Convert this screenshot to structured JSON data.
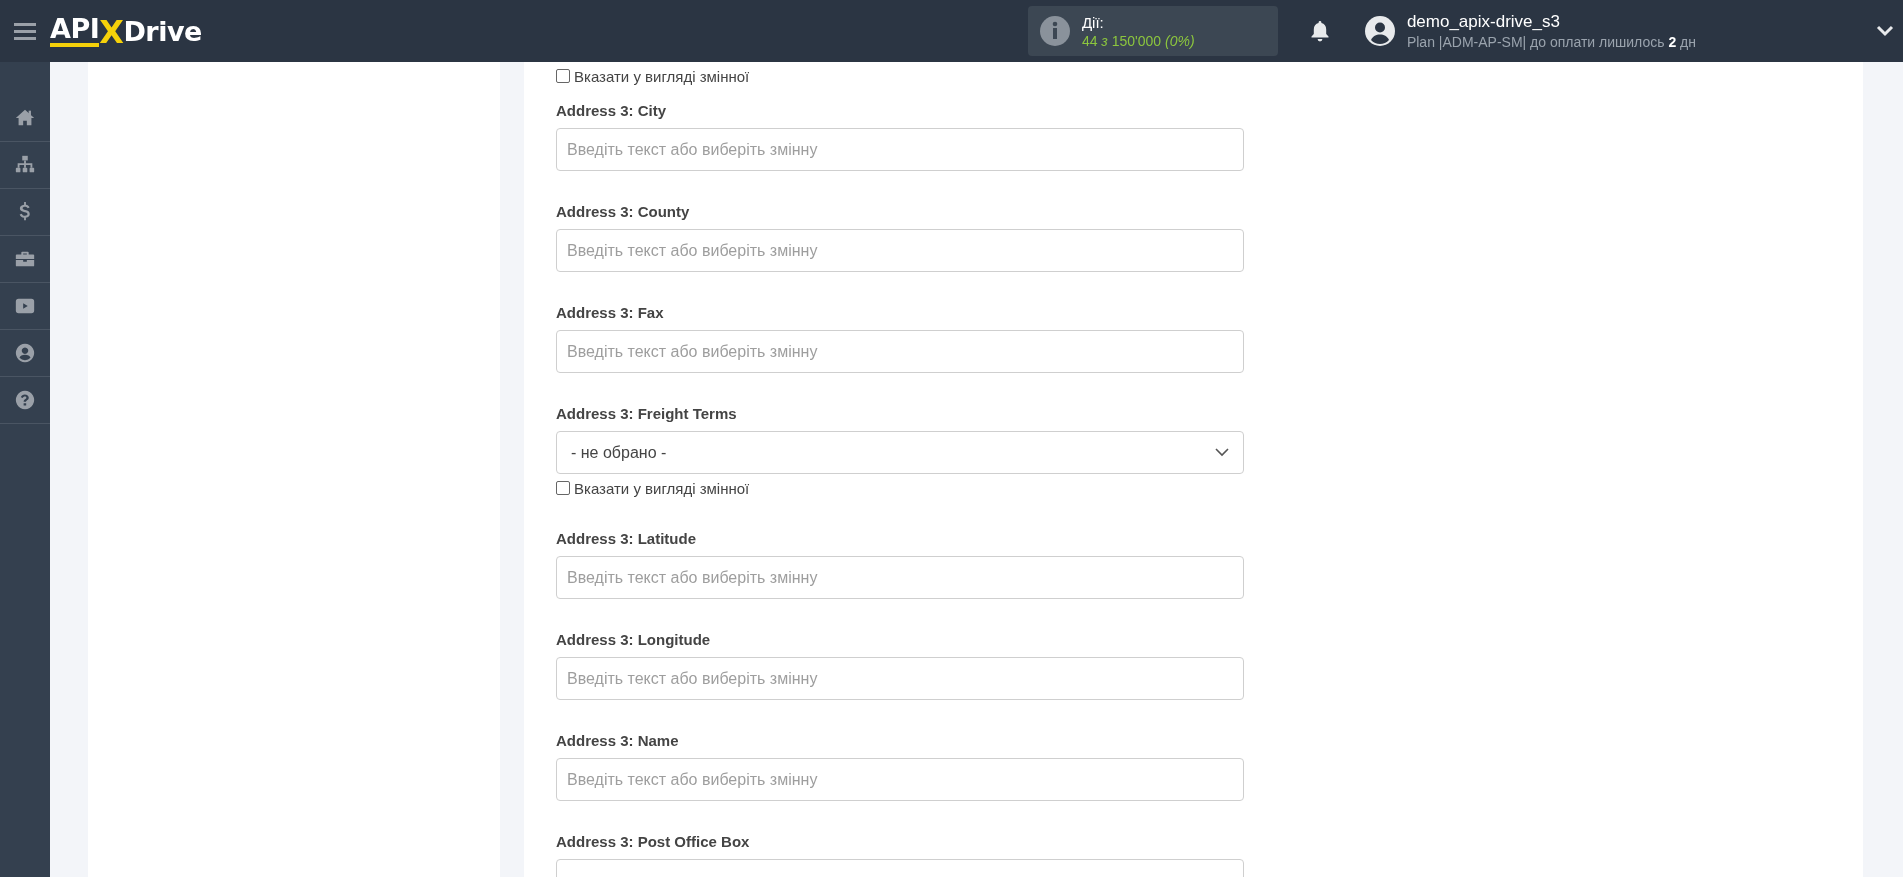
{
  "header": {
    "logo": [
      "API",
      "X",
      "Drive"
    ],
    "actions": {
      "label": "Дії:",
      "usage": "44 *з* 150'000 *(0%)*"
    },
    "user": {
      "name": "demo_apix-drive_s3",
      "plan": "Plan |ADM-AP-SM| до оплати лишилось **2** дн"
    }
  },
  "sidebar": {
    "items": [
      {
        "kind": "home"
      },
      {
        "kind": "hierarchy"
      },
      {
        "kind": "dollar"
      },
      {
        "kind": "briefcase"
      },
      {
        "kind": "video"
      },
      {
        "kind": "user"
      },
      {
        "kind": "help"
      }
    ]
  },
  "form": {
    "top_checkbox": {
      "label": "Вказати у вигляді змінної",
      "checked": false
    },
    "fields": [
      {
        "kind": "text",
        "label": "Address 3: City",
        "placeholder": "Введіть текст або виберіть змінну"
      },
      {
        "kind": "text",
        "label": "Address 3: County",
        "placeholder": "Введіть текст або виберіть змінну"
      },
      {
        "kind": "text",
        "label": "Address 3: Fax",
        "placeholder": "Введіть текст або виберіть змінну"
      },
      {
        "kind": "select",
        "label": "Address 3: Freight Terms",
        "value": "- не обрано -",
        "checkbox": {
          "label": "Вказати у вигляді змінної",
          "checked": false
        }
      },
      {
        "kind": "text",
        "label": "Address 3: Latitude",
        "placeholder": "Введіть текст або виберіть змінну"
      },
      {
        "kind": "text",
        "label": "Address 3: Longitude",
        "placeholder": "Введіть текст або виберіть змінну"
      },
      {
        "kind": "text",
        "label": "Address 3: Name",
        "placeholder": "Введіть текст або виберіть змінну"
      },
      {
        "kind": "text",
        "label": "Address 3: Post Office Box"
      }
    ]
  }
}
